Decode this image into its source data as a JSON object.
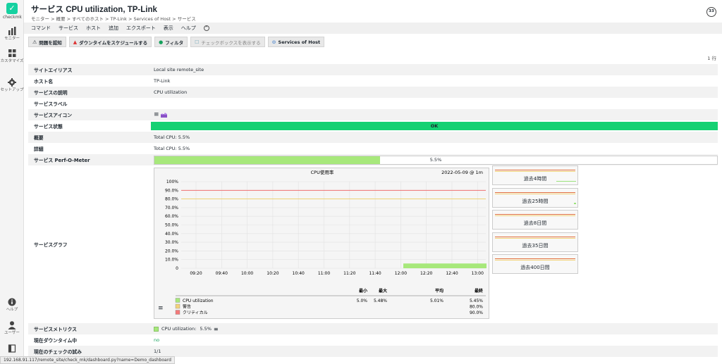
{
  "sidebar": {
    "logo_text": "checkmk",
    "items": [
      {
        "label": "モニター",
        "icon": "bar-chart-icon"
      },
      {
        "label": "カスタマイズ",
        "icon": "grid-icon"
      },
      {
        "label": "セットアップ",
        "icon": "gear-icon"
      }
    ],
    "bottom_items": [
      {
        "label": "ヘルプ",
        "icon": "info-icon"
      },
      {
        "label": "ユーザー",
        "icon": "user-icon"
      }
    ]
  },
  "header": {
    "title": "サービス CPU utilization, TP-Link",
    "breadcrumb": "モニター > 概要 > すべてのホスト > TP-Link > Services of Host > サービス",
    "reload_counter": "33"
  },
  "menubar": [
    "コマンド",
    "サービス",
    "ホスト",
    "追加",
    "エクスポート",
    "表示",
    "ヘルプ"
  ],
  "toolbar": [
    {
      "label": "問題を認知",
      "icon": "ack-icon"
    },
    {
      "label": "ダウンタイムをスケジュールする",
      "icon": "downtime-icon"
    },
    {
      "label": "フィルタ",
      "icon": "filter-icon"
    },
    {
      "label": "チェックボックスを表示する",
      "icon": "checkbox-icon"
    },
    {
      "label": "Services of Host",
      "icon": "services-icon"
    }
  ],
  "row_count": "1 行",
  "rows": {
    "site_alias": {
      "key": "サイトエイリアス",
      "value": "Local site remote_site"
    },
    "host_name": {
      "key": "ホスト名",
      "value": "TP-Link"
    },
    "service_desc": {
      "key": "サービスの説明",
      "value": "CPU utilization"
    },
    "service_labels": {
      "key": "サービスラベル",
      "value": ""
    },
    "service_icons": {
      "key": "サービスアイコン",
      "value": ""
    },
    "service_state": {
      "key": "サービス状態",
      "value": "OK"
    },
    "summary": {
      "key": "概要",
      "value": "Total CPU: 5.5%"
    },
    "details": {
      "key": "詳細",
      "value": "Total CPU: 5.5%"
    },
    "perf_o_meter": {
      "key": "サービス Perf-O-Meter",
      "value": "5.5%",
      "fraction": 0.055
    },
    "service_graph": {
      "key": "サービスグラフ"
    },
    "service_metrics": {
      "key": "サービスメトリクス",
      "label": "CPU utilization:",
      "value": "5.5%"
    },
    "current_downtime": {
      "key": "現在ダウンタイム中",
      "value": "no"
    },
    "current_attempt": {
      "key": "現在のチェックの試み",
      "value": "1/1"
    }
  },
  "graph": {
    "title": "CPU使用率",
    "timestamp": "2022-05-09 @ 1m",
    "legend_headers": [
      "最小",
      "最大",
      "平均",
      "最終"
    ],
    "legend_rows": [
      {
        "name": "CPU utilization",
        "color": "#a7e87b",
        "min": "5.0%",
        "max": "5.48%",
        "avg": "5.01%",
        "last": "5.45%"
      },
      {
        "name": "警告",
        "color": "#f2d27a",
        "min": "",
        "max": "",
        "avg": "",
        "last": "80.0%"
      },
      {
        "name": "クリティカル",
        "color": "#f47a7a",
        "min": "",
        "max": "",
        "avg": "",
        "last": "90.0%"
      }
    ],
    "mini_labels": [
      "過去4時間",
      "過去25時間",
      "過去8日間",
      "過去35日間",
      "過去400日間"
    ]
  },
  "chart_data": {
    "type": "area",
    "title": "CPU使用率",
    "x_ticks": [
      "09:20",
      "09:40",
      "10:00",
      "10:20",
      "10:40",
      "11:00",
      "11:20",
      "11:40",
      "12:00",
      "12:20",
      "12:40",
      "13:00"
    ],
    "y_ticks": [
      "100%",
      "90.0%",
      "80.0%",
      "70.0%",
      "60.0%",
      "50.0%",
      "40.0%",
      "30.0%",
      "20.0%",
      "10.0%",
      "0"
    ],
    "ylim": [
      0,
      100
    ],
    "series": [
      {
        "name": "CPU utilization",
        "color": "#a7e87b",
        "x_start": "12:02",
        "x_end": "13:07",
        "value": 5.5
      },
      {
        "name": "警告",
        "color": "#f2d27a",
        "value": 80
      },
      {
        "name": "クリティカル",
        "color": "#f47a7a",
        "value": 90
      }
    ],
    "grid": true
  },
  "status_url": "192.168.91.117/remote_site/check_mk/dashboard.py?name=Demo_dashboard"
}
